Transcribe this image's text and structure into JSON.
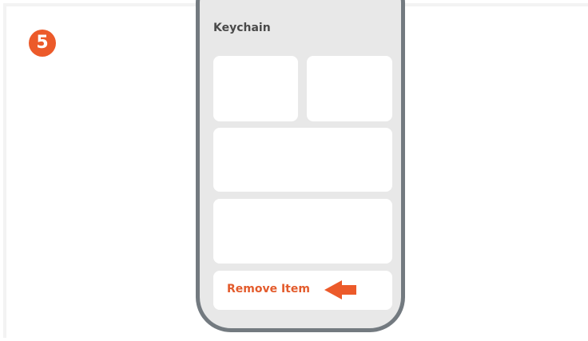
{
  "step": {
    "number": "5"
  },
  "screen": {
    "title": "Keychain"
  },
  "actions": {
    "remove_label": "Remove Item"
  },
  "colors": {
    "accent": "#ec5a2a",
    "accent_text": "#e35b2c",
    "phone_frame": "#737a80",
    "screen_bg": "#e8e8e8",
    "card_bg": "#ffffff"
  },
  "icons": {
    "pointer": "left-arrow-icon"
  }
}
